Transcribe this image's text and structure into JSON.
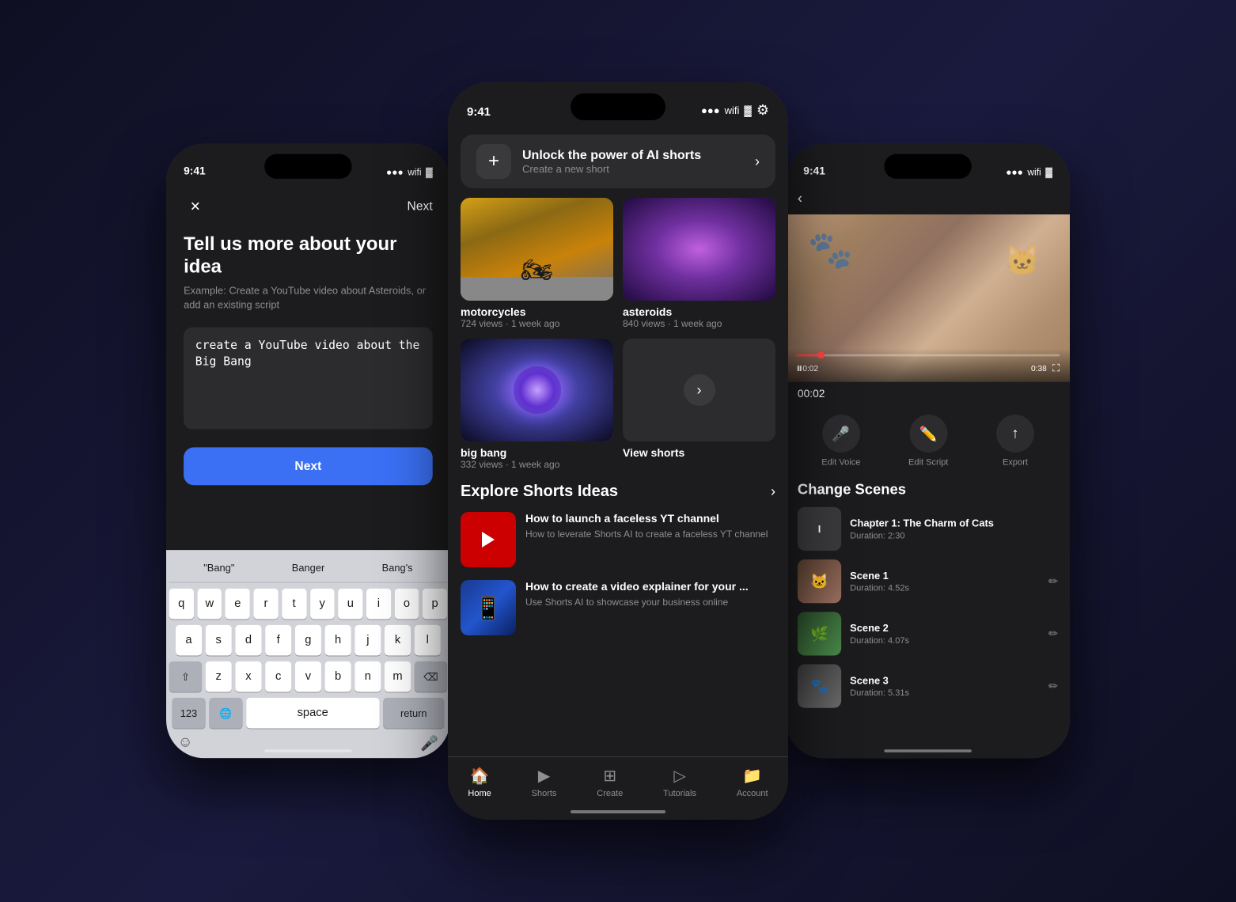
{
  "phones": {
    "left": {
      "status_time": "9:41",
      "signal": "●●●",
      "wifi": "WiFi",
      "next_label": "Next",
      "title": "Tell us more about your idea",
      "subtitle": "Example: Create a YouTube video about Asteroids, or add an existing script",
      "textarea_value": "create a YouTube video about the Big Bang",
      "next_button_label": "Next",
      "keyboard": {
        "suggestions": [
          "\"Bang\"",
          "Banger",
          "Bang's"
        ],
        "row1": [
          "q",
          "w",
          "e",
          "r",
          "t",
          "y",
          "u",
          "i",
          "o",
          "p"
        ],
        "row2": [
          "a",
          "s",
          "d",
          "f",
          "g",
          "h",
          "j",
          "k",
          "l"
        ],
        "row3": [
          "z",
          "x",
          "c",
          "v",
          "b",
          "n",
          "m"
        ],
        "space_label": "space",
        "num_label": "123",
        "return_label": "return"
      }
    },
    "center": {
      "status_time": "9:41",
      "cta_title": "Unlock the power of AI shorts",
      "cta_subtitle": "Create a new short",
      "videos": [
        {
          "title": "motorcycles",
          "meta": "724 views · 1 week ago",
          "type": "moto"
        },
        {
          "title": "asteroids",
          "meta": "840 views · 1 week ago",
          "type": "galaxy"
        },
        {
          "title": "big bang",
          "meta": "332 views · 1 week ago",
          "type": "bigbang"
        },
        {
          "title": "View shorts",
          "meta": "",
          "type": "viewmore"
        }
      ],
      "explore_title": "Explore Shorts Ideas",
      "ideas": [
        {
          "title": "How to launch a faceless YT channel",
          "desc": "How to leverate Shorts AI to create a faceless YT channel",
          "type": "yt"
        },
        {
          "title": "How to create a video explainer for your ...",
          "desc": "Use Shorts AI to showcase your business online",
          "type": "social"
        }
      ],
      "tabs": [
        {
          "label": "Home",
          "icon": "🏠",
          "active": true
        },
        {
          "label": "Shorts",
          "icon": "▶",
          "active": false
        },
        {
          "label": "Create",
          "icon": "⊞",
          "active": false
        },
        {
          "label": "Tutorials",
          "icon": "▷",
          "active": false
        },
        {
          "label": "Account",
          "icon": "📁",
          "active": false
        }
      ]
    },
    "right": {
      "status_time": "9:41",
      "current_time": "00:02",
      "time_start": "0:02",
      "time_end": "0:38",
      "actions": [
        {
          "label": "Edit Voice",
          "icon": "🎤"
        },
        {
          "label": "Edit Script",
          "icon": "✏️"
        },
        {
          "label": "Export",
          "icon": "↑"
        }
      ],
      "change_scenes_title": "Change Scenes",
      "scenes": [
        {
          "title": "Chapter 1: The Charm of Cats",
          "duration": "Duration: 2:30",
          "type": "chapter"
        },
        {
          "title": "Scene 1",
          "duration": "Duration: 4.52s",
          "type": "s1"
        },
        {
          "title": "Scene 2",
          "duration": "Duration: 4.07s",
          "type": "s2"
        },
        {
          "title": "Scene 3",
          "duration": "Duration: 5.31s",
          "type": "s3"
        }
      ]
    }
  }
}
